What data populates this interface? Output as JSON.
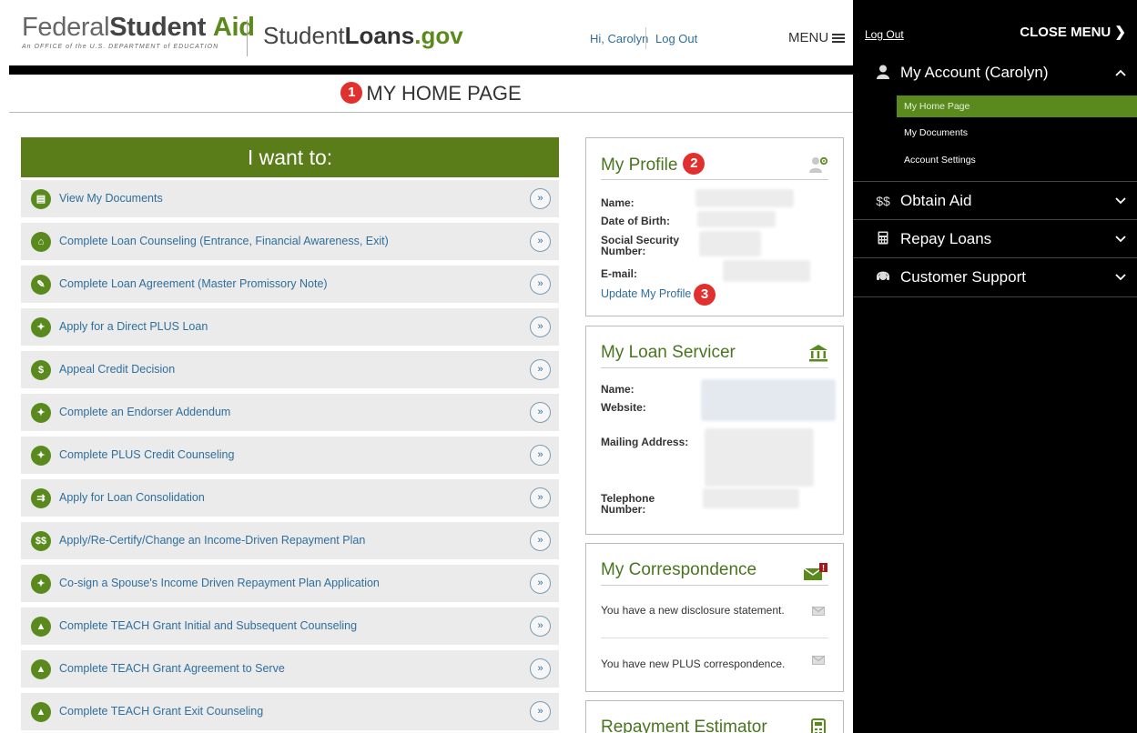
{
  "header": {
    "logo_fsa": {
      "part1": "Federal",
      "part2": "Student",
      "part3": "Aid",
      "tagline": "An OFFICE of the U.S. DEPARTMENT of EDUCATION"
    },
    "logo_sl": {
      "part1": "Student",
      "part2": "Loans",
      "part3": ".gov"
    },
    "greeting": "Hi, Carolyn",
    "logout": "Log Out",
    "menu": "MENU"
  },
  "page": {
    "title": "MY HOME PAGE",
    "badge": "1"
  },
  "want": {
    "title": "I want to:",
    "items": [
      {
        "label": "View My Documents",
        "icon": "document-icon",
        "glyph": "▤"
      },
      {
        "label": "Complete Loan Counseling (Entrance, Financial Awareness, Exit)",
        "icon": "bank-icon",
        "glyph": "⌂"
      },
      {
        "label": "Complete Loan Agreement (Master Promissory Note)",
        "icon": "pencil-icon",
        "glyph": "✎"
      },
      {
        "label": "Apply for a Direct PLUS Loan",
        "icon": "family-icon",
        "glyph": "✦"
      },
      {
        "label": "Appeal Credit Decision",
        "icon": "dollar-circle-icon",
        "glyph": "$"
      },
      {
        "label": "Complete an Endorser Addendum",
        "icon": "people-icon",
        "glyph": "✦"
      },
      {
        "label": "Complete PLUS Credit Counseling",
        "icon": "parent-child-icon",
        "glyph": "✦"
      },
      {
        "label": "Apply for Loan Consolidation",
        "icon": "merge-icon",
        "glyph": "⇉"
      },
      {
        "label": "Apply/Re-Certify/Change an Income-Driven Repayment Plan",
        "icon": "dollars-icon",
        "glyph": "$$"
      },
      {
        "label": "Co-sign a Spouse's Income Driven Repayment Plan Application",
        "icon": "couple-icon",
        "glyph": "✦"
      },
      {
        "label": "Complete TEACH Grant Initial and Subsequent Counseling",
        "icon": "graduation-cap-icon",
        "glyph": "▲"
      },
      {
        "label": "Complete TEACH Grant Agreement to Serve",
        "icon": "graduation-cap-icon",
        "glyph": "▲"
      },
      {
        "label": "Complete TEACH Grant Exit Counseling",
        "icon": "graduation-cap-icon",
        "glyph": "▲"
      }
    ],
    "go_glyph": "»"
  },
  "profile": {
    "title": "My Profile",
    "badge": "2",
    "name_label": "Name:",
    "dob_label": "Date of Birth:",
    "ssn_label1": "Social Security",
    "ssn_label2": "Number:",
    "email_label": "E-mail:",
    "update_link": "Update My Profile",
    "update_badge": "3"
  },
  "servicer": {
    "title": "My Loan Servicer",
    "name_label": "Name:",
    "website_label": "Website:",
    "mailing_label": "Mailing Address:",
    "phone_label1": "Telephone",
    "phone_label2": "Number:"
  },
  "correspondence": {
    "title": "My Correspondence",
    "alert": "!",
    "messages": [
      "You have a new disclosure statement.",
      "You have new PLUS correspondence."
    ]
  },
  "estimator": {
    "title": "Repayment Estimator"
  },
  "side_menu": {
    "logout": "Log Out",
    "close": "CLOSE MENU",
    "close_chevron": "❯",
    "sections": [
      {
        "label": "My Account (Carolyn)",
        "icon": "person-icon",
        "glyph": "●",
        "chevron": "⌃"
      },
      {
        "label": "Obtain Aid",
        "icon": "dollars-icon",
        "glyph": "$$",
        "chevron": "⌄"
      },
      {
        "label": "Repay Loans",
        "icon": "calculator-icon",
        "glyph": "▦",
        "chevron": "⌄"
      },
      {
        "label": "Customer Support",
        "icon": "headset-icon",
        "glyph": "◉",
        "chevron": "⌄"
      }
    ],
    "account_items": [
      "My Home Page",
      "My Documents",
      "Account Settings"
    ]
  },
  "colors": {
    "green": "#5a8a1e",
    "green_dark": "#5a7d1a",
    "link": "#2f6e9c",
    "badge": "#e0312f",
    "menu_bg": "#000000"
  }
}
